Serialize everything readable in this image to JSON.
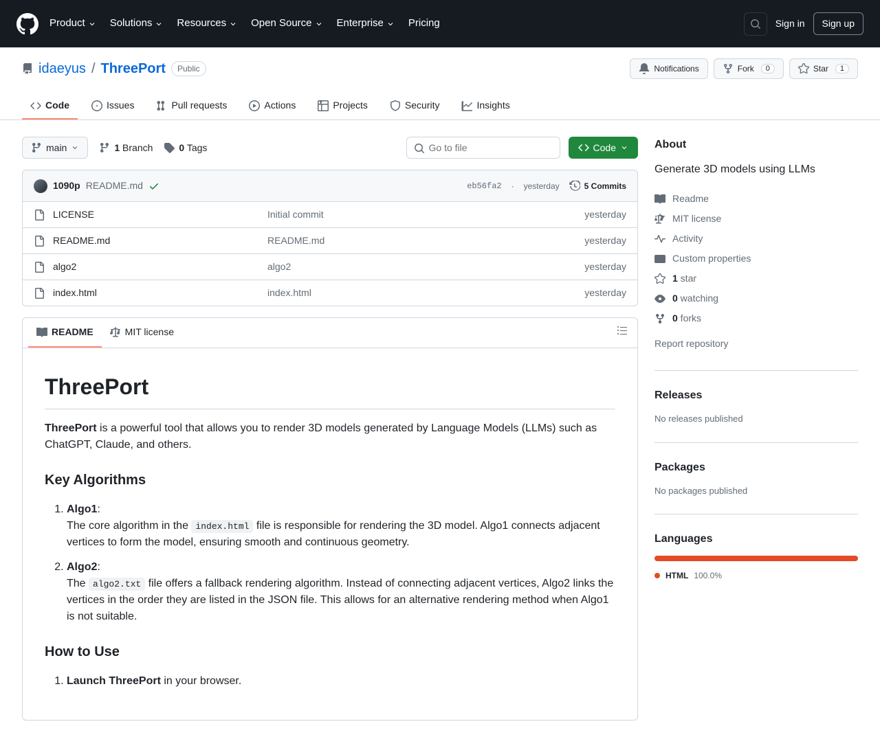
{
  "header": {
    "nav": [
      "Product",
      "Solutions",
      "Resources",
      "Open Source",
      "Enterprise",
      "Pricing"
    ],
    "sign_in": "Sign in",
    "sign_up": "Sign up"
  },
  "repo": {
    "owner": "idaeyus",
    "name": "ThreePort",
    "visibility": "Public",
    "actions": {
      "notifications": "Notifications",
      "fork": "Fork",
      "fork_count": "0",
      "star": "Star",
      "star_count": "1"
    },
    "tabs": [
      "Code",
      "Issues",
      "Pull requests",
      "Actions",
      "Projects",
      "Security",
      "Insights"
    ]
  },
  "fileNav": {
    "branch": "main",
    "branches_count": "1",
    "branches_label": "Branch",
    "tags_count": "0",
    "tags_label": "Tags",
    "goto_placeholder": "Go to file",
    "code_btn": "Code"
  },
  "commit": {
    "author": "1090p",
    "message": "README.md",
    "sha": "eb56fa2",
    "time": "yesterday",
    "commits_count": "5 Commits"
  },
  "files": [
    {
      "name": "LICENSE",
      "msg": "Initial commit",
      "time": "yesterday"
    },
    {
      "name": "README.md",
      "msg": "README.md",
      "time": "yesterday"
    },
    {
      "name": "algo2",
      "msg": "algo2",
      "time": "yesterday"
    },
    {
      "name": "index.html",
      "msg": "index.html",
      "time": "yesterday"
    }
  ],
  "readmeTabs": {
    "readme": "README",
    "license": "MIT license"
  },
  "readme": {
    "title": "ThreePort",
    "intro_bold": "ThreePort",
    "intro_rest": " is a powerful tool that allows you to render 3D models generated by Language Models (LLMs) such as ChatGPT, Claude, and others.",
    "h_algo": "Key Algorithms",
    "algo1_head": "Algo1",
    "algo1_pre": "The core algorithm in the ",
    "algo1_code": "index.html",
    "algo1_post": " file is responsible for rendering the 3D model. Algo1 connects adjacent vertices to form the model, ensuring smooth and continuous geometry.",
    "algo2_head": "Algo2",
    "algo2_pre": "The ",
    "algo2_code": "algo2.txt",
    "algo2_post": " file offers a fallback rendering algorithm. Instead of connecting adjacent vertices, Algo2 links the vertices in the order they are listed in the JSON file. This allows for an alternative rendering method when Algo1 is not suitable.",
    "h_how": "How to Use",
    "how1_bold": "Launch ThreePort",
    "how1_rest": " in your browser."
  },
  "about": {
    "title": "About",
    "desc": "Generate 3D models using LLMs",
    "links": {
      "readme": "Readme",
      "license": "MIT license",
      "activity": "Activity",
      "custom": "Custom properties"
    },
    "stars_n": "1",
    "stars_l": " star",
    "watch_n": "0",
    "watch_l": " watching",
    "forks_n": "0",
    "forks_l": " forks",
    "report": "Report repository"
  },
  "releases": {
    "title": "Releases",
    "empty": "No releases published"
  },
  "packages": {
    "title": "Packages",
    "empty": "No packages published"
  },
  "languages": {
    "title": "Languages",
    "name": "HTML",
    "pct": "100.0%"
  }
}
